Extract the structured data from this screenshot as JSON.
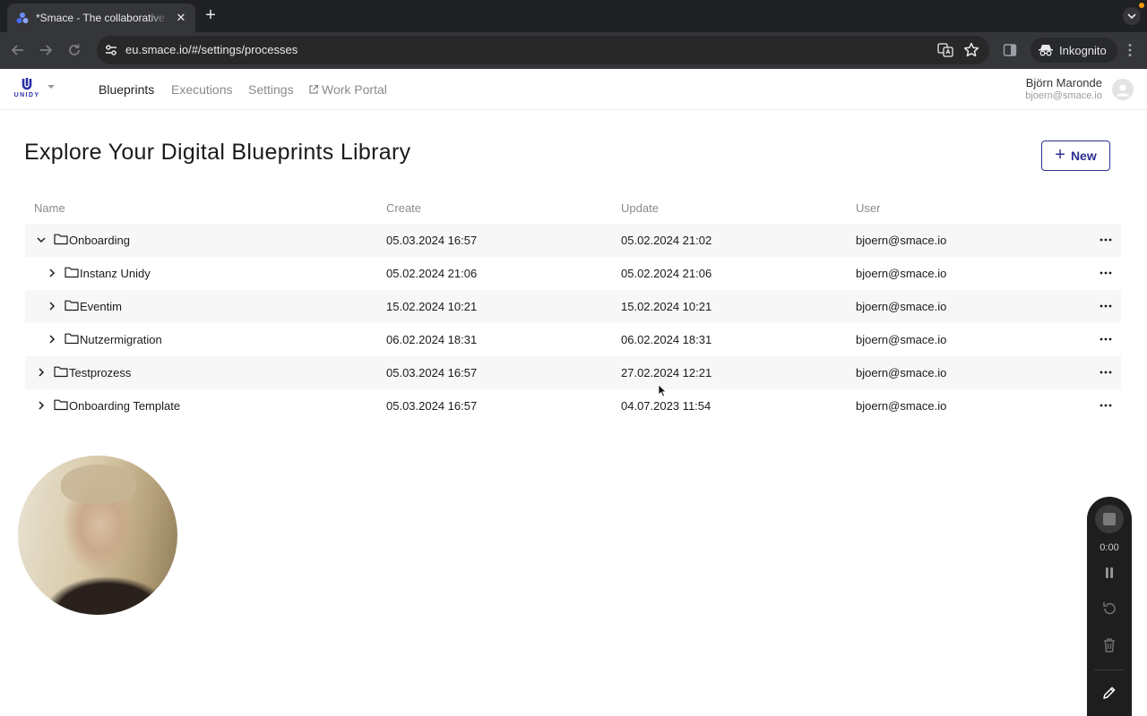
{
  "browser": {
    "tab_title": "*Smace - The collaborative s",
    "tab_close": "✕",
    "new_tab": "+",
    "url": "eu.smace.io/#/settings/processes",
    "incognito_label": "Inkognito"
  },
  "app": {
    "logo_text": "UNIDY",
    "nav": {
      "blueprints": "Blueprints",
      "executions": "Executions",
      "settings": "Settings",
      "work_portal": "Work Portal"
    },
    "user": {
      "name": "Björn Maronde",
      "email": "bjoern@smace.io"
    }
  },
  "main": {
    "title": "Explore Your Digital Blueprints Library",
    "new_button": "New",
    "columns": {
      "name": "Name",
      "create": "Create",
      "update": "Update",
      "user": "User"
    },
    "rows": [
      {
        "name": "Onboarding",
        "create": "05.03.2024 16:57",
        "update": "05.02.2024 21:02",
        "user": "bjoern@smace.io",
        "expanded": true,
        "level": 0
      },
      {
        "name": "Instanz Unidy",
        "create": "05.02.2024 21:06",
        "update": "05.02.2024 21:06",
        "user": "bjoern@smace.io",
        "expanded": false,
        "level": 1
      },
      {
        "name": "Eventim",
        "create": "15.02.2024 10:21",
        "update": "15.02.2024 10:21",
        "user": "bjoern@smace.io",
        "expanded": false,
        "level": 1
      },
      {
        "name": "Nutzermigration",
        "create": "06.02.2024 18:31",
        "update": "06.02.2024 18:31",
        "user": "bjoern@smace.io",
        "expanded": false,
        "level": 1
      },
      {
        "name": "Testprozess",
        "create": "05.03.2024 16:57",
        "update": "27.02.2024 12:21",
        "user": "bjoern@smace.io",
        "expanded": false,
        "level": 0
      },
      {
        "name": "Onboarding Template",
        "create": "05.03.2024 16:57",
        "update": "04.07.2023 11:54",
        "user": "bjoern@smace.io",
        "expanded": false,
        "level": 0
      }
    ]
  },
  "recorder": {
    "time": "0:00"
  },
  "icons": {
    "tab_favicon": "smace-logo-icon",
    "chevron_down": "chevron-down-icon",
    "chevron_right": "chevron-right-icon",
    "folder": "folder-icon",
    "more": "more-horizontal-icon",
    "external": "external-link-icon",
    "plus": "plus-icon"
  },
  "colors": {
    "accent": "#2b2f8f",
    "row_shade": "#f7f7f7",
    "chrome_dark": "#202124"
  }
}
